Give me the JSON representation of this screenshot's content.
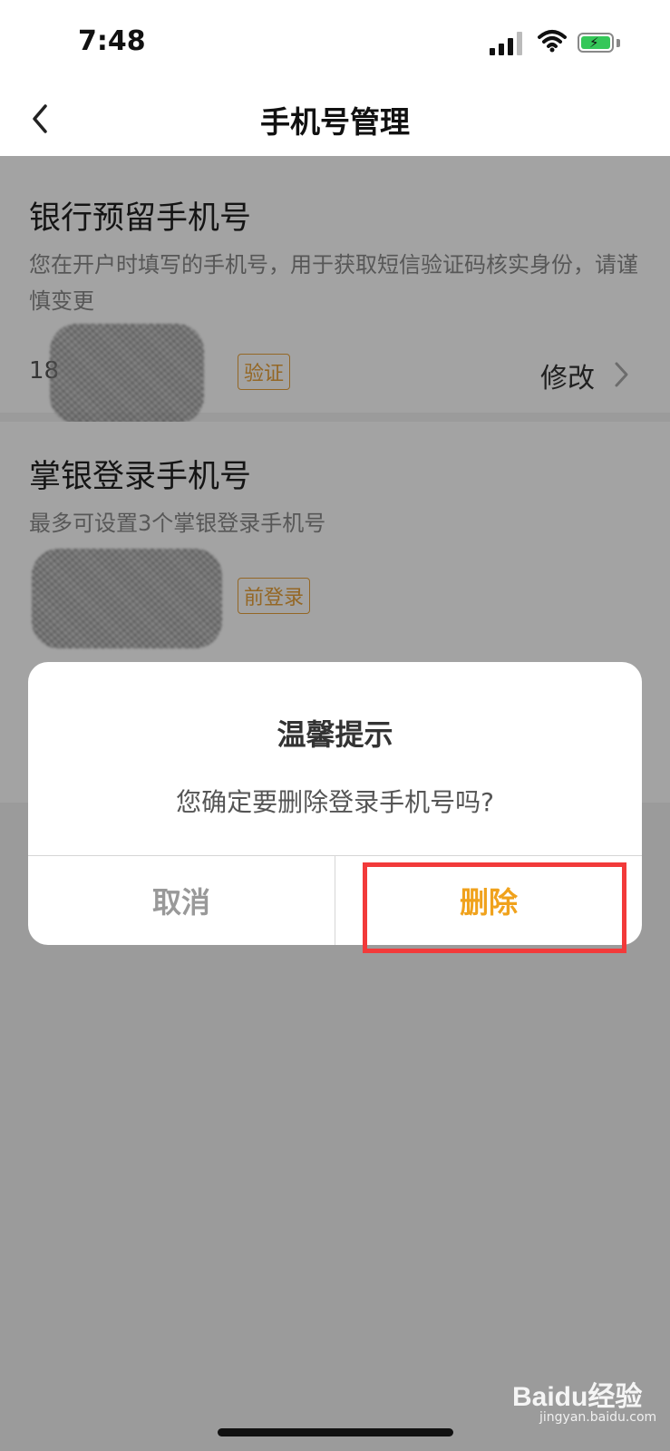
{
  "status_bar": {
    "time": "7:48"
  },
  "nav": {
    "title": "手机号管理",
    "back_icon": "chevron-left-icon"
  },
  "bank_section": {
    "title": "银行预留手机号",
    "description": "您在开户时填写的手机号，用于获取短信验证码核实身份，请谨慎变更",
    "phone_partial": "18",
    "tag": "验证",
    "action": "修改"
  },
  "login_section": {
    "title": "掌银登录手机号",
    "description": "最多可设置3个掌银登录手机号",
    "tag": "前登录"
  },
  "dialog": {
    "title": "温馨提示",
    "message": "您确定要删除登录手机号吗?",
    "cancel_label": "取消",
    "delete_label": "删除"
  },
  "watermark": {
    "brand": "Baidu经验",
    "url": "jingyan.baidu.com"
  },
  "colors": {
    "accent": "#f0a21c",
    "highlight": "#f23a3a",
    "battery": "#35c759"
  }
}
